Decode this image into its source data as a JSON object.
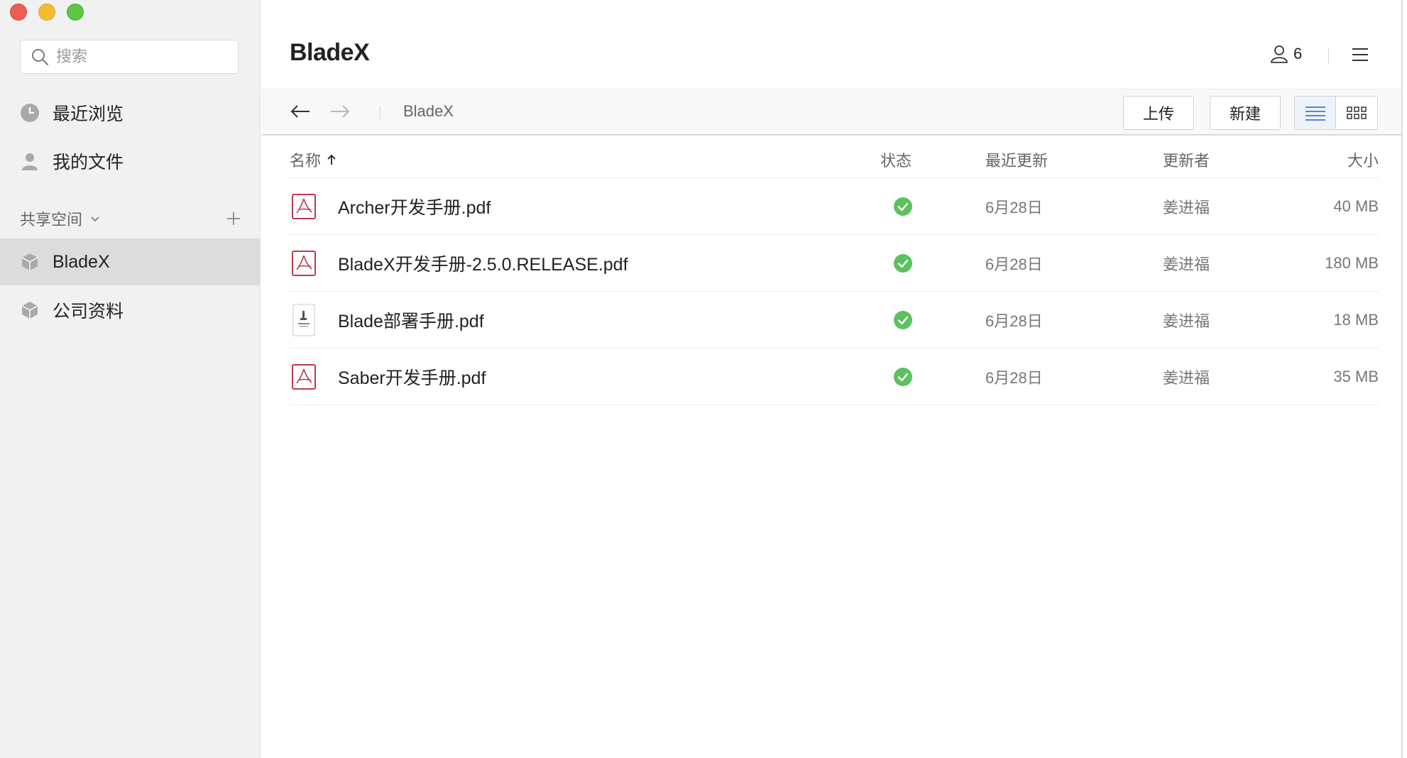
{
  "sidebar": {
    "search_placeholder": "搜索",
    "recent_label": "最近浏览",
    "my_files_label": "我的文件",
    "shared_title": "共享空间",
    "spaces": [
      {
        "label": "BladeX",
        "active": true
      },
      {
        "label": "公司资料",
        "active": false
      }
    ]
  },
  "header": {
    "title": "BladeX",
    "member_count": "6"
  },
  "toolbar": {
    "breadcrumb": "BladeX",
    "upload_label": "上传",
    "new_label": "新建",
    "view_mode": "list"
  },
  "table": {
    "columns": {
      "name": "名称",
      "status": "状态",
      "updated": "最近更新",
      "updater": "更新者",
      "size": "大小"
    },
    "sort": {
      "column": "name",
      "direction": "ascending"
    },
    "rows": [
      {
        "icon": "pdf-icon",
        "name": "Archer开发手册.pdf",
        "status": "synced",
        "updated": "6月28日",
        "updater": "姜进福",
        "size": "40 MB"
      },
      {
        "icon": "pdf-icon",
        "name": "BladeX开发手册-2.5.0.RELEASE.pdf",
        "status": "synced",
        "updated": "6月28日",
        "updater": "姜进福",
        "size": "180 MB"
      },
      {
        "icon": "document-thumbnail-icon",
        "name": "Blade部署手册.pdf",
        "status": "synced",
        "updated": "6月28日",
        "updater": "姜进福",
        "size": "18 MB"
      },
      {
        "icon": "pdf-icon",
        "name": "Saber开发手册.pdf",
        "status": "synced",
        "updated": "6月28日",
        "updater": "姜进福",
        "size": "35 MB"
      }
    ]
  },
  "colors": {
    "status_ok": "#5cc15f",
    "pdf_red": "#c0394b",
    "accent_blue": "#3a78d8",
    "sidebar_bg": "#f1f1f2",
    "active_item_bg": "#dcdcdd"
  }
}
